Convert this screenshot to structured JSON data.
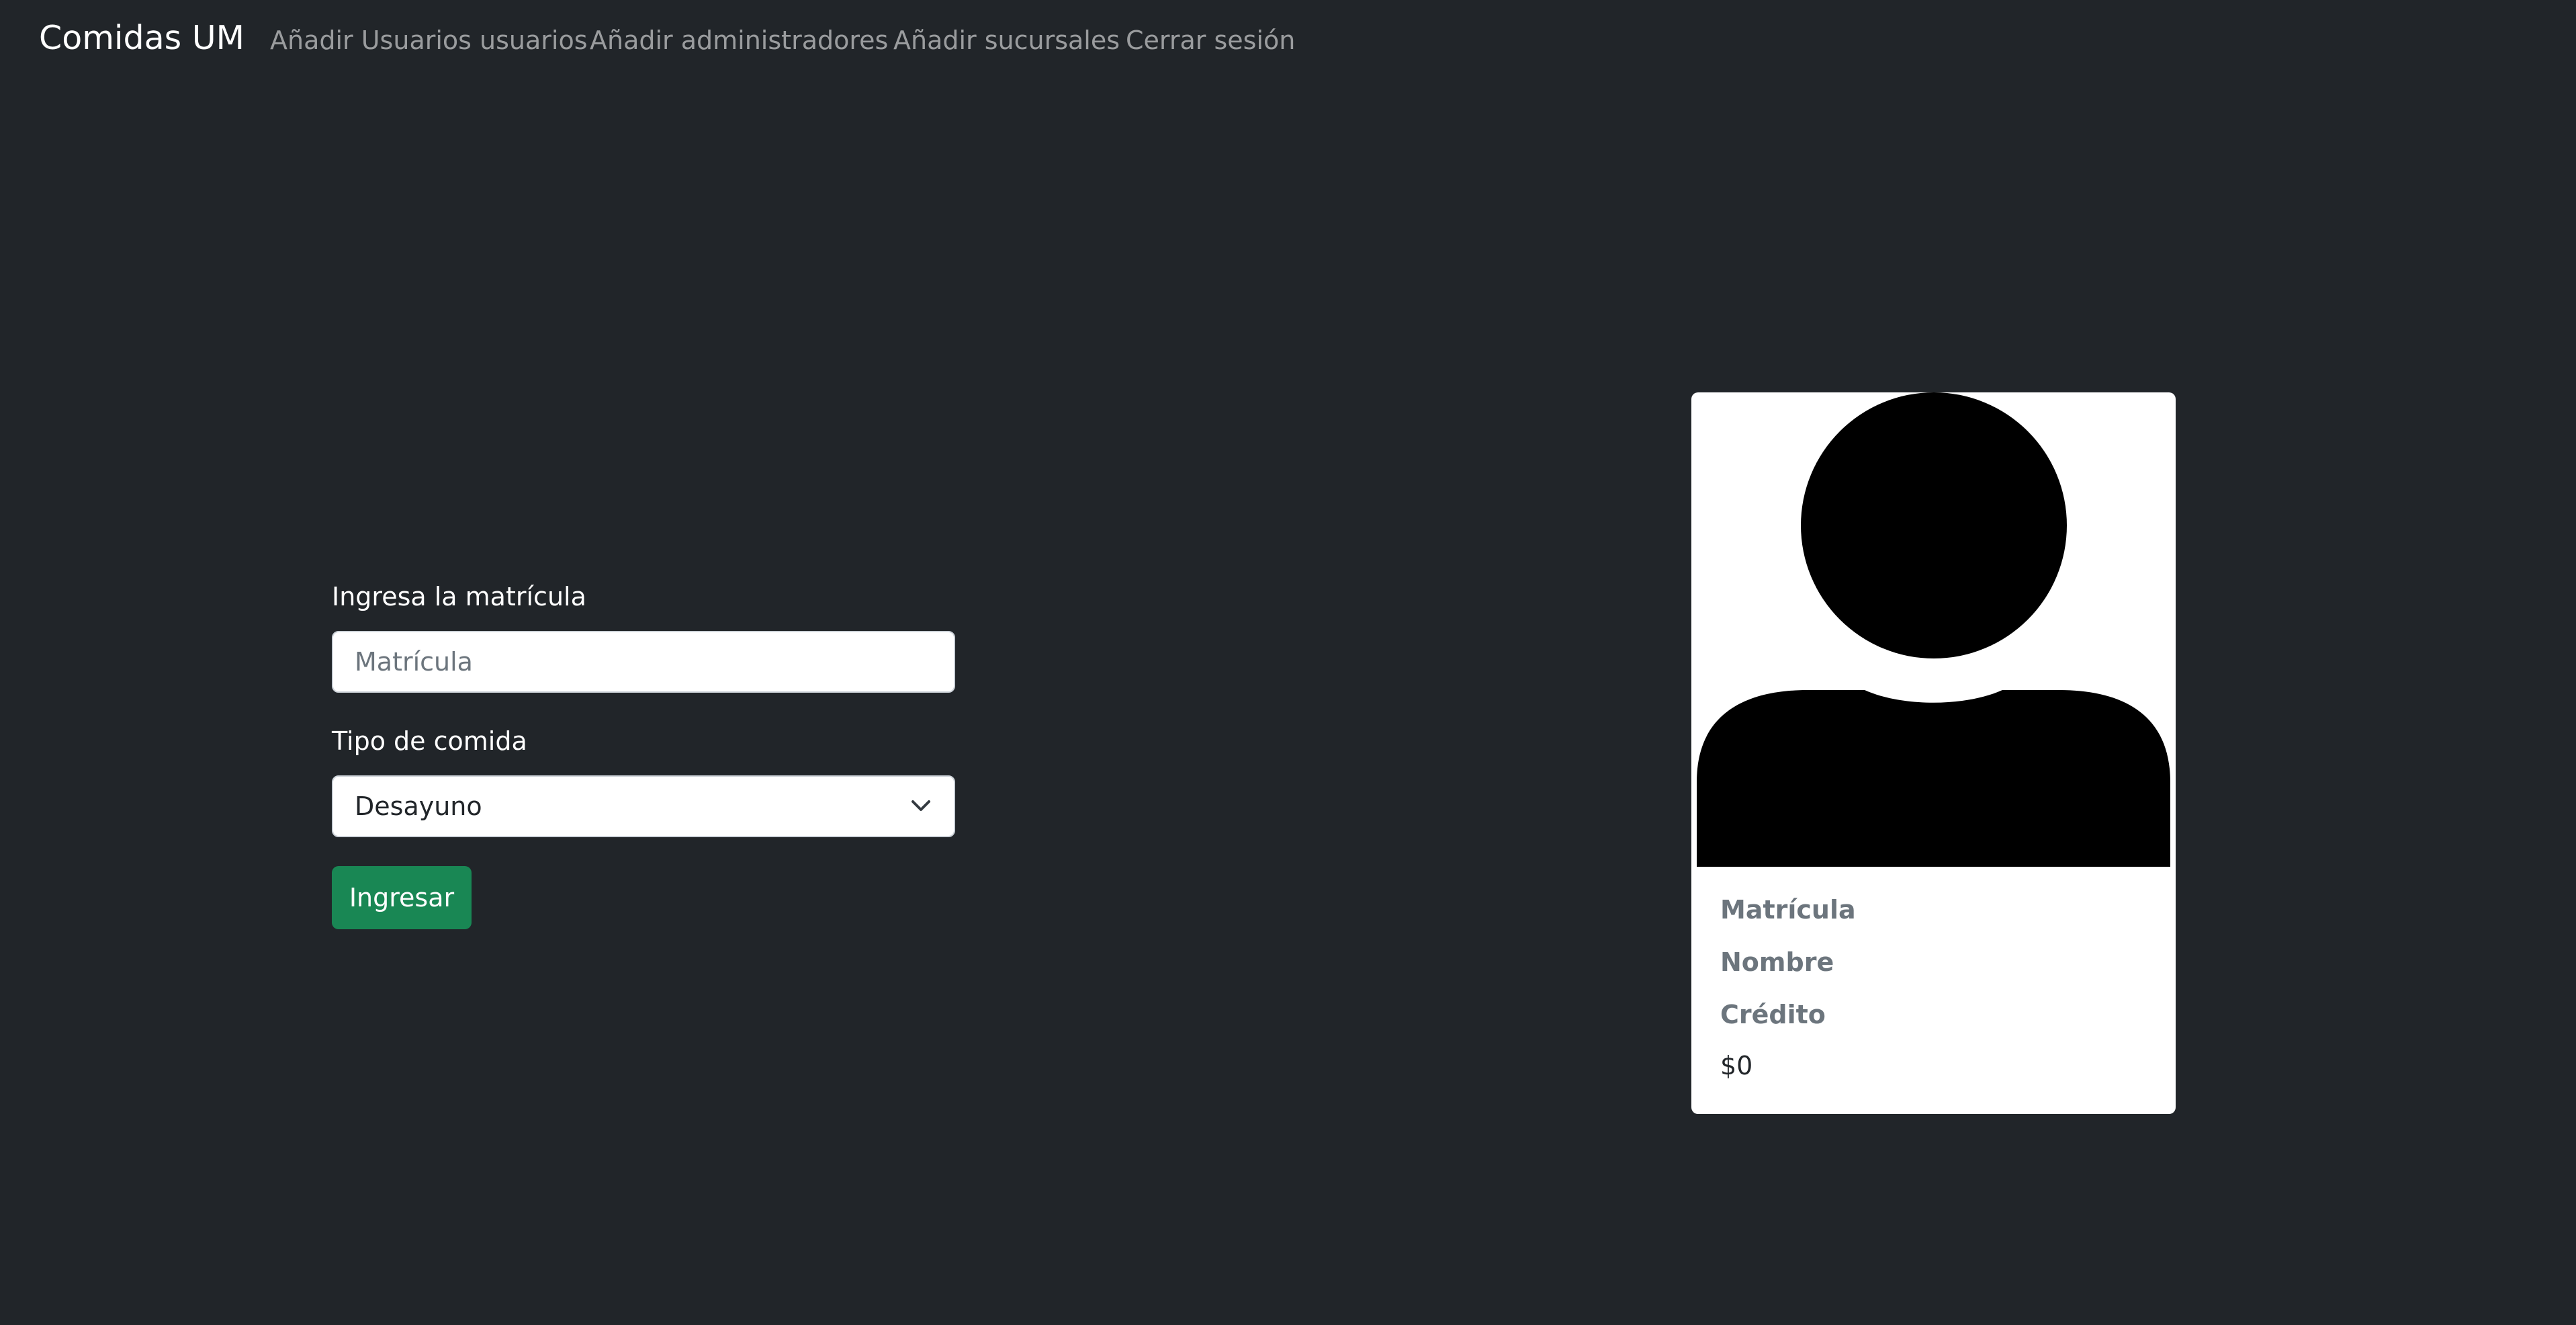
{
  "navbar": {
    "brand": "Comidas UM",
    "links": [
      {
        "label": "Añadir Usuarios usuarios"
      },
      {
        "label": "Añadir administradores"
      },
      {
        "label": "Añadir sucursales"
      },
      {
        "label": "Cerrar sesión"
      }
    ]
  },
  "form": {
    "matricula_label": "Ingresa la matrícula",
    "matricula_placeholder": "Matrícula",
    "matricula_value": "",
    "comida_label": "Tipo de comida",
    "comida_selected": "Desayuno",
    "submit_label": "Ingresar"
  },
  "card": {
    "matricula_label": "Matrícula",
    "nombre_label": "Nombre",
    "credito_label": "Crédito",
    "credito_value": "$0"
  },
  "icons": {
    "avatar": "person-silhouette-icon",
    "select": "chevron-down-icon"
  },
  "colors": {
    "background": "#212529",
    "button": "#198754",
    "muted": "#6c757d"
  }
}
